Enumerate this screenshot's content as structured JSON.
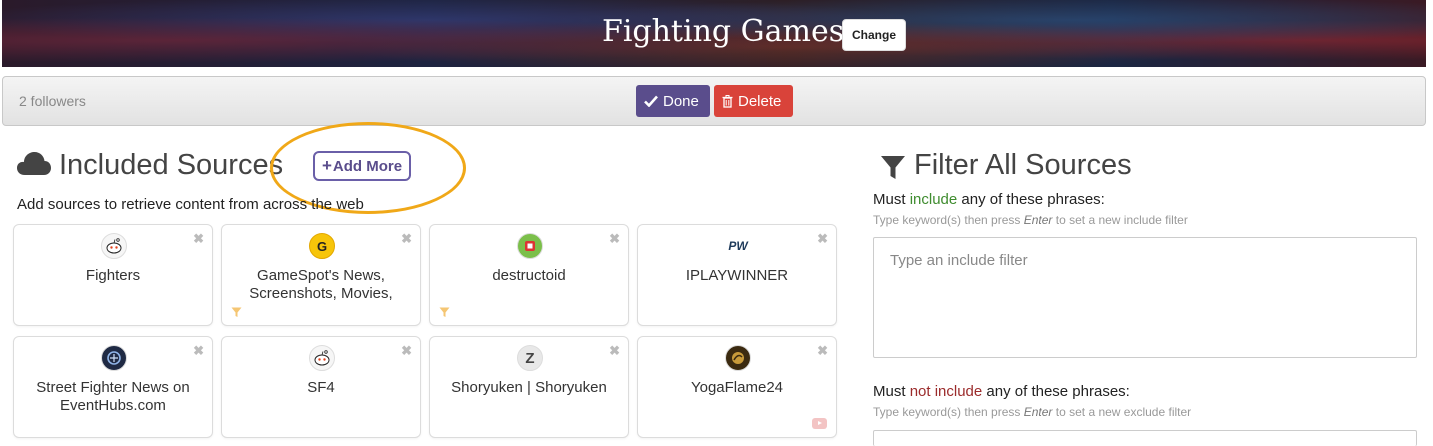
{
  "banner": {
    "title": "Fighting Games",
    "change_label": "Change"
  },
  "toolbar": {
    "followers": "2 followers",
    "done_label": "Done",
    "delete_label": "Delete"
  },
  "included": {
    "title": "Included Sources",
    "add_more_label": "Add More",
    "subtitle": "Add sources to retrieve content from across the web",
    "sources": [
      {
        "name": "Fighters",
        "icon": "reddit-icon",
        "filter": false,
        "youtube": false
      },
      {
        "name": "GameSpot's News, Screenshots, Movies,",
        "icon": "gamespot-icon",
        "filter": true,
        "youtube": false
      },
      {
        "name": "destructoid",
        "icon": "destructoid-icon",
        "filter": true,
        "youtube": false
      },
      {
        "name": "IPLAYWINNER",
        "icon": "iplaywinner-icon",
        "filter": false,
        "youtube": false
      },
      {
        "name": "Street Fighter News on EventHubs.com",
        "icon": "eventhubs-icon",
        "filter": false,
        "youtube": false
      },
      {
        "name": "SF4",
        "icon": "reddit-icon",
        "filter": false,
        "youtube": false
      },
      {
        "name": "Shoryuken | Shoryuken",
        "icon": "shoryuken-icon",
        "filter": false,
        "youtube": false
      },
      {
        "name": "YogaFlame24",
        "icon": "yogaflame-icon",
        "filter": false,
        "youtube": true
      }
    ]
  },
  "filters": {
    "title": "Filter All Sources",
    "include": {
      "label_prefix": "Must ",
      "label_keyword": "include",
      "label_suffix": " any of these phrases:",
      "hint_prefix": "Type keyword(s) then press ",
      "hint_key": "Enter",
      "hint_suffix": " to set a new include filter",
      "placeholder": "Type an include filter"
    },
    "exclude": {
      "label_prefix": "Must ",
      "label_keyword": "not include",
      "label_suffix": " any of these phrases:",
      "hint_prefix": "Type keyword(s) then press ",
      "hint_key": "Enter",
      "hint_suffix": " to set a new exclude filter"
    }
  },
  "colors": {
    "accent": "#5a4d8c",
    "danger": "#d9433a",
    "highlight": "#f0a818"
  }
}
